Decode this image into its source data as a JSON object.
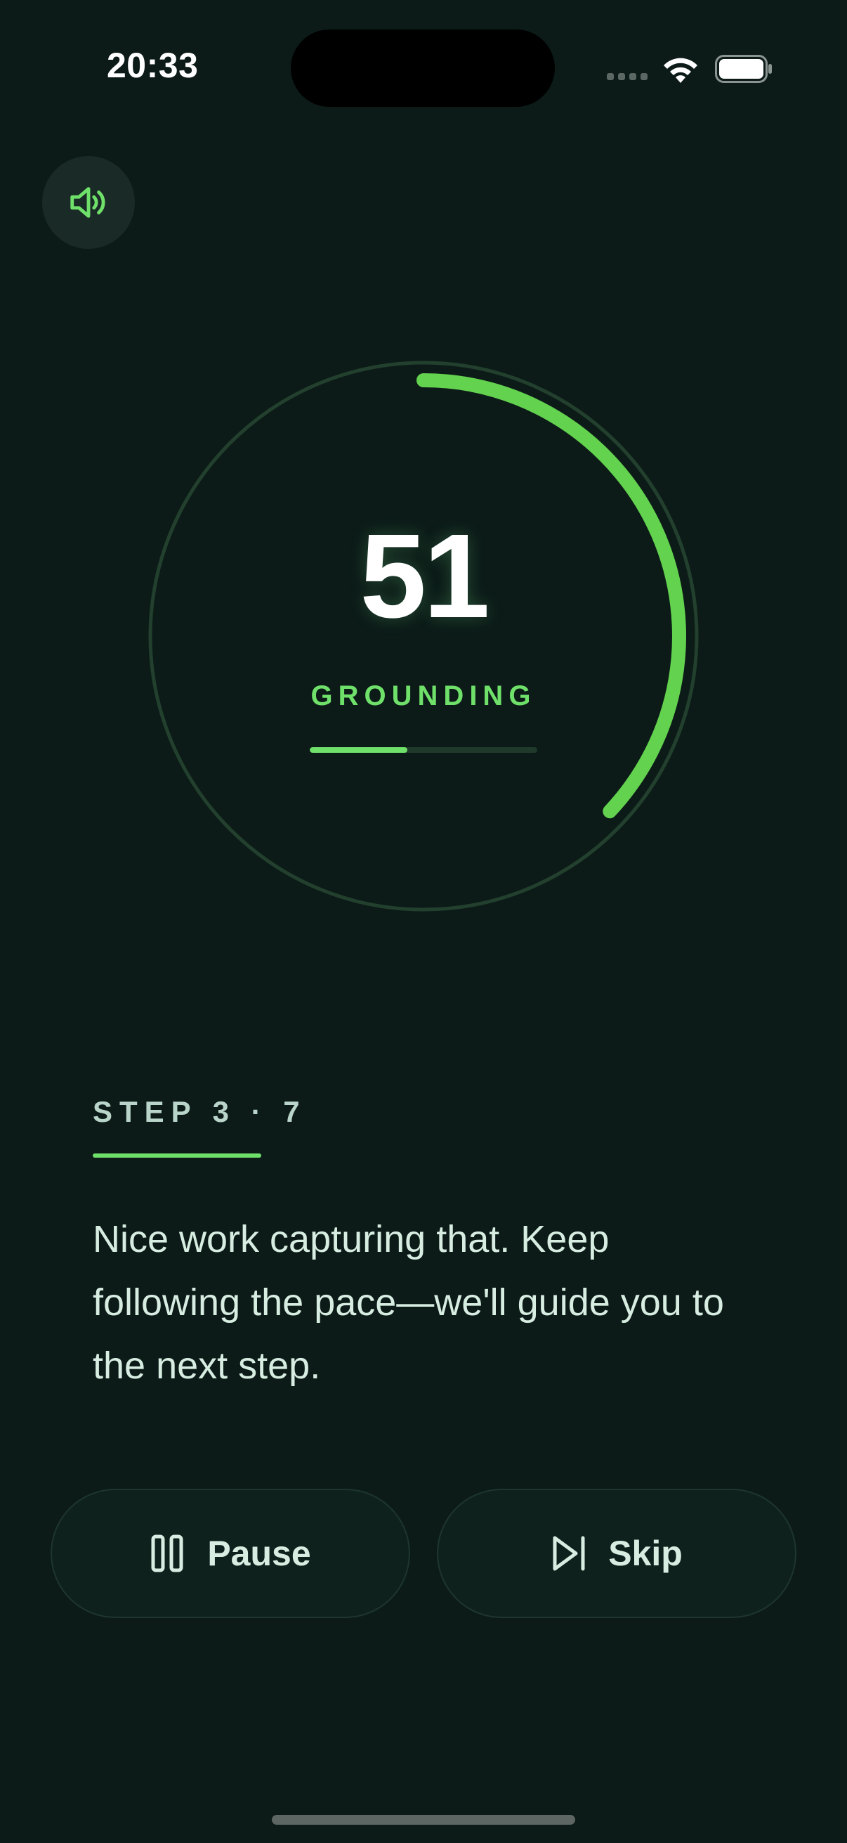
{
  "status_bar": {
    "time": "20:33",
    "wifi_icon": "wifi-icon",
    "battery_icon": "battery-icon"
  },
  "sound_button": {
    "icon": "speaker-icon"
  },
  "timer": {
    "value": "51",
    "phase": "GROUNDING",
    "ring_progress": 0.37,
    "phase_progress": 0.43
  },
  "step": {
    "label": "STEP 3 · 7",
    "message": "Nice work capturing that. Keep following the pace—we'll guide you to the next step."
  },
  "controls": {
    "pause_label": "Pause",
    "pause_icon": "pause-icon",
    "skip_label": "Skip",
    "skip_icon": "skip-forward-icon"
  },
  "colors": {
    "background": "#0c1b18",
    "accent": "#6fe06a",
    "ring_track": "#22402d"
  }
}
